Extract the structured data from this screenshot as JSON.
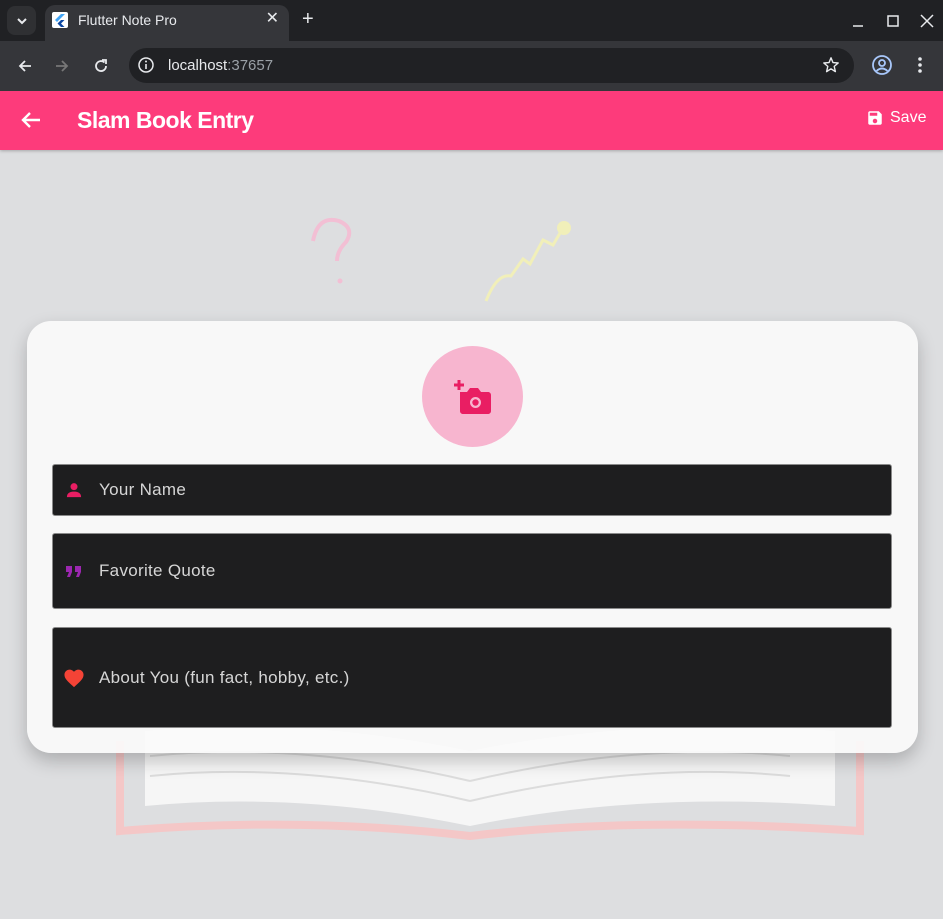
{
  "browser": {
    "tab_title": "Flutter Note Pro",
    "url_host": "localhost",
    "url_port": ":37657"
  },
  "app": {
    "title": "Slam Book Entry",
    "save_label": "Save",
    "accent_color": "#fd3b7b",
    "fields": [
      {
        "label": "Your Name",
        "icon": "person-icon"
      },
      {
        "label": "Favorite Quote",
        "icon": "quote-icon"
      },
      {
        "label": "About You (fun fact, hobby, etc.)",
        "icon": "heart-icon"
      }
    ]
  }
}
